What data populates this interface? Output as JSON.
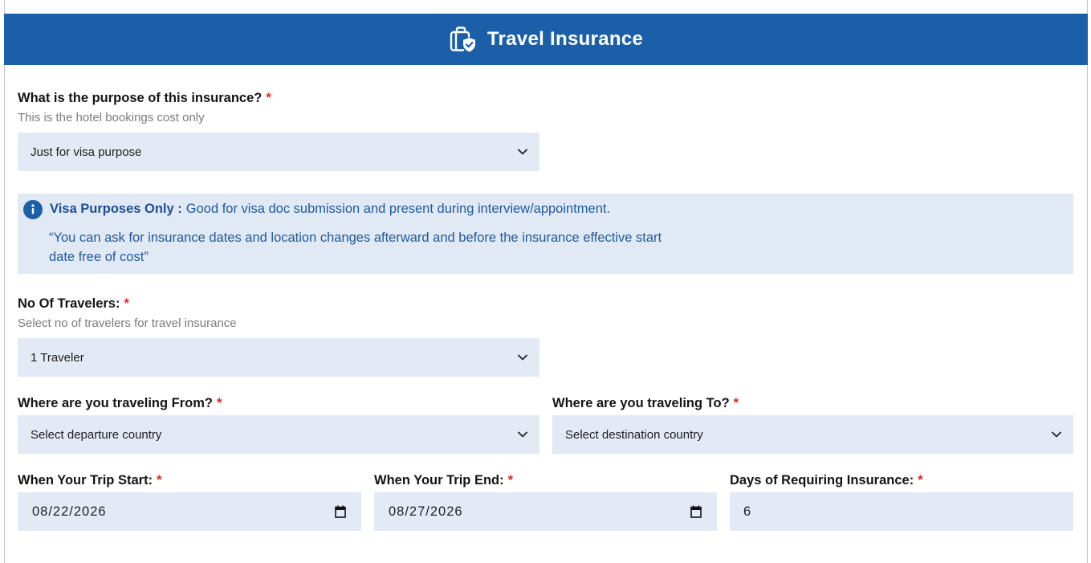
{
  "theme": {
    "accent": "#1c5fa9",
    "field_background": "#e3eaf5",
    "notice_background": "#e1e9f4",
    "notice_text": "#1f5a9e",
    "required_color": "#e0262a"
  },
  "header": {
    "title": "Travel Insurance",
    "icon": "luggage-shield-icon"
  },
  "required_mark": "*",
  "purpose": {
    "label": "What is the purpose of this insurance?",
    "help": "This is the hotel bookings cost only",
    "selected": "Just for visa purpose",
    "icon": "chevron-down-icon"
  },
  "notice": {
    "icon": "info-icon",
    "title": "Visa Purposes Only :",
    "text": "Good for visa doc submission and present during interview/appointment.",
    "quote": "“You can ask for insurance dates and location changes afterward and before the insurance effective start date free of cost”"
  },
  "travelers": {
    "label": "No Of Travelers:",
    "help": "Select no of travelers for travel insurance",
    "selected": "1 Traveler",
    "icon": "chevron-down-icon"
  },
  "origin": {
    "label": "Where are you traveling From?",
    "selected": "Select departure country",
    "icon": "chevron-down-icon"
  },
  "destination": {
    "label": "Where are you traveling To?",
    "selected": "Select destination country",
    "icon": "chevron-down-icon"
  },
  "trip_start": {
    "label": "When Your Trip Start:",
    "value": "08/22/2026",
    "icon": "calendar-icon"
  },
  "trip_end": {
    "label": "When Your Trip End:",
    "value": "08/27/2026",
    "icon": "calendar-icon"
  },
  "days": {
    "label": "Days of Requiring Insurance:",
    "value": "6"
  }
}
